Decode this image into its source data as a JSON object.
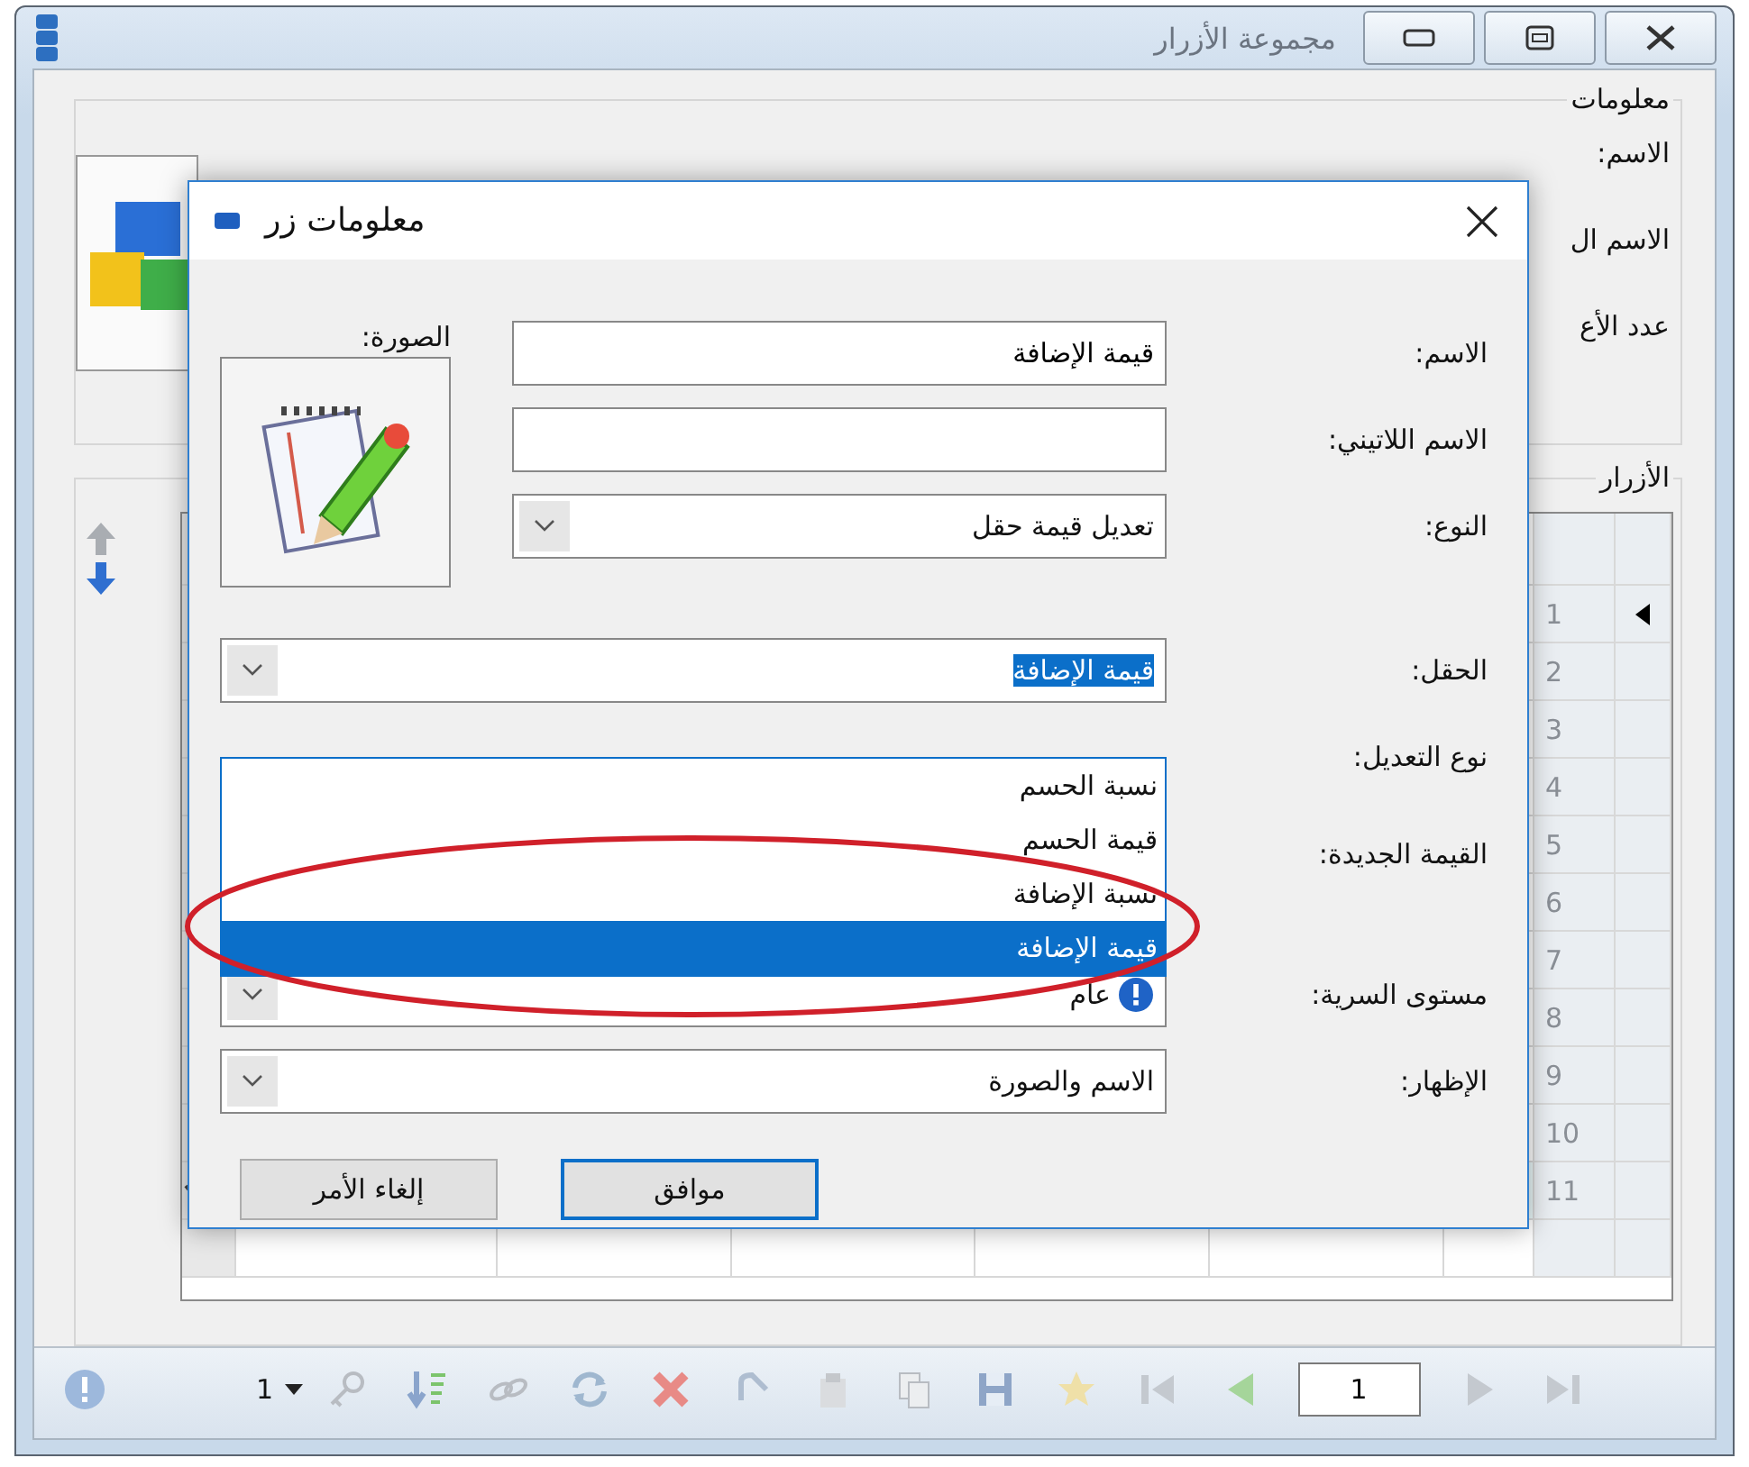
{
  "window": {
    "title": "مجموعة الأزرار"
  },
  "info_group": {
    "title": "معلومات",
    "labels": [
      "الاسم:",
      "الاسم ال",
      "عدد الأع"
    ]
  },
  "buttons_group": {
    "title": "الأزرار",
    "rows": [
      {
        "number": "1",
        "current": true
      },
      {
        "number": "2",
        "current": false
      },
      {
        "number": "3",
        "current": false
      },
      {
        "number": "4",
        "current": false
      },
      {
        "number": "5",
        "current": false
      },
      {
        "number": "6",
        "current": false
      },
      {
        "number": "7",
        "current": false
      },
      {
        "number": "8",
        "current": false
      },
      {
        "number": "9",
        "current": false
      },
      {
        "number": "10",
        "current": false
      },
      {
        "number": "11",
        "current": false
      }
    ]
  },
  "toolbar": {
    "record_count": "1",
    "page": "1"
  },
  "dialog": {
    "title": "معلومات زر",
    "picture_label": "الصورة:",
    "fields": [
      {
        "label": "الاسم:",
        "kind": "text",
        "value": "قيمة الإضافة"
      },
      {
        "label": "الاسم اللاتيني:",
        "kind": "text"
      },
      {
        "label": "النوع:",
        "kind": "combo",
        "value": "تعديل قيمة حقل"
      },
      {
        "label": "الحقل:",
        "kind": "combo",
        "value": "قيمة الإضافة",
        "highlighted": true
      },
      {
        "label": "نوع التعديل:",
        "kind": "covered"
      },
      {
        "label": "القيمة الجديدة:",
        "kind": "covered"
      },
      {
        "label": "مستوى السرية:",
        "kind": "combo",
        "value": "عام",
        "info_icon": true
      },
      {
        "label": "الإظهار:",
        "kind": "combo",
        "value": "الاسم والصورة"
      }
    ],
    "dropdown": {
      "items": [
        {
          "label": "نسبة الحسم",
          "selected": false
        },
        {
          "label": "قيمة الحسم",
          "selected": false
        },
        {
          "label": "نسبة الإضافة",
          "selected": false
        },
        {
          "label": "قيمة الإضافة",
          "selected": true
        }
      ]
    },
    "buttons": [
      {
        "label": "موافق",
        "default": true
      },
      {
        "label": "إلغاء الأمر",
        "default": false
      }
    ]
  }
}
